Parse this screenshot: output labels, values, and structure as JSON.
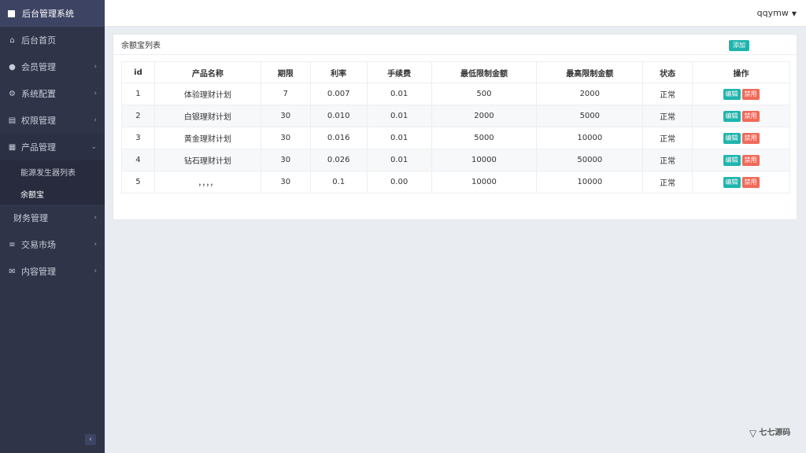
{
  "brand": {
    "title": "后台管理系统"
  },
  "header": {
    "user": "qqymw"
  },
  "sidebar": {
    "items": [
      {
        "label": "后台首页",
        "icon": "home-icon"
      },
      {
        "label": "会员管理",
        "icon": "user-icon"
      },
      {
        "label": "系统配置",
        "icon": "cogs-icon"
      },
      {
        "label": "权限管理",
        "icon": "list-icon"
      },
      {
        "label": "产品管理",
        "icon": "windows-icon"
      }
    ],
    "sub_items": [
      {
        "label": "能源发生器列表"
      },
      {
        "label": "余额宝"
      }
    ],
    "items_after": [
      {
        "label": "财务管理"
      },
      {
        "label": "交易市场",
        "icon": "bars-icon"
      },
      {
        "label": "内容管理",
        "icon": "envelope-icon"
      }
    ],
    "collapse": "‹"
  },
  "panel": {
    "title": "余额宝列表",
    "add_label": "添加",
    "columns": [
      "id",
      "产品名称",
      "期限",
      "利率",
      "手续费",
      "最低限制金额",
      "最高限制金额",
      "状态",
      "操作"
    ],
    "rows": [
      {
        "id": "1",
        "name": "体验理财计划",
        "term": "7",
        "rate": "0.007",
        "fee": "0.01",
        "min": "500",
        "max": "2000",
        "status": "正常"
      },
      {
        "id": "2",
        "name": "白银理财计划",
        "term": "30",
        "rate": "0.010",
        "fee": "0.01",
        "min": "2000",
        "max": "5000",
        "status": "正常"
      },
      {
        "id": "3",
        "name": "黄金理财计划",
        "term": "30",
        "rate": "0.016",
        "fee": "0.01",
        "min": "5000",
        "max": "10000",
        "status": "正常"
      },
      {
        "id": "4",
        "name": "钻石理财计划",
        "term": "30",
        "rate": "0.026",
        "fee": "0.01",
        "min": "10000",
        "max": "50000",
        "status": "正常"
      },
      {
        "id": "5",
        "name": "，，，，",
        "term": "30",
        "rate": "0.1",
        "fee": "0.00",
        "min": "10000",
        "max": "10000",
        "status": "正常"
      }
    ],
    "edit_label": "编辑",
    "disable_label": "禁用"
  },
  "watermark": {
    "text": "七七源码"
  },
  "colors": {
    "sidebar": "#2f3449",
    "brand": "#3d4463",
    "accent": "#1fb5ad",
    "danger": "#f06a5a",
    "background": "#e9ecf0"
  }
}
